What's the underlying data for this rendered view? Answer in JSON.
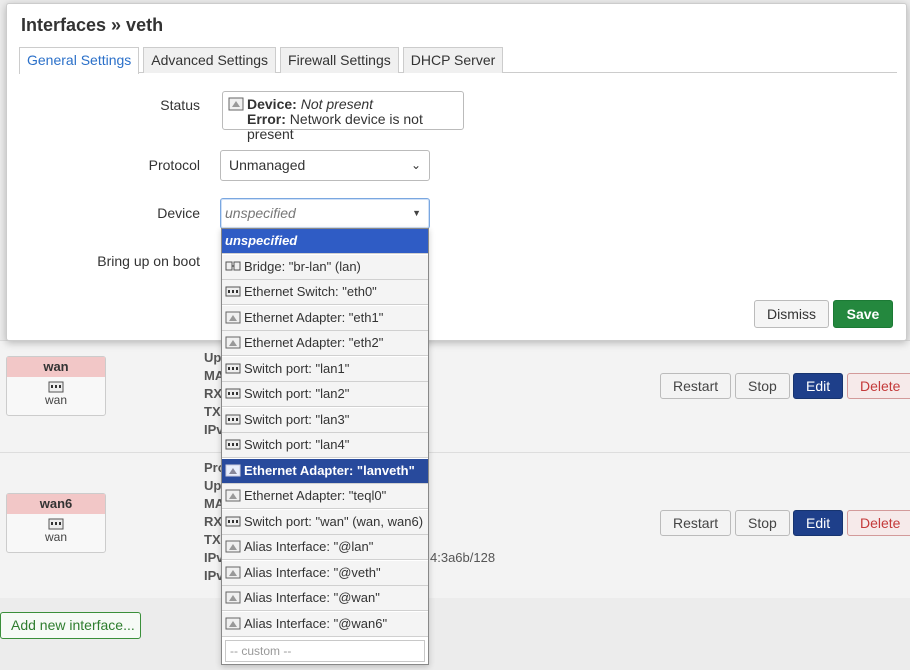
{
  "modal": {
    "title": "Interfaces » veth",
    "tabs": [
      "General Settings",
      "Advanced Settings",
      "Firewall Settings",
      "DHCP Server"
    ],
    "fields": {
      "status_label": "Status",
      "status_device_key": "Device:",
      "status_device_val": "Not present",
      "status_error_key": "Error:",
      "status_error_val": "Network device is not present",
      "protocol_label": "Protocol",
      "protocol_value": "Unmanaged",
      "device_label": "Device",
      "device_placeholder": "unspecified",
      "bringup_label": "Bring up on boot"
    },
    "dismiss_label": "Dismiss",
    "save_label": "Save"
  },
  "dropdown": {
    "items": [
      {
        "label": "unspecified",
        "icon": "none"
      },
      {
        "label": "Bridge: \"br-lan\" (lan)",
        "icon": "bridge-icon"
      },
      {
        "label": "Ethernet Switch: \"eth0\"",
        "icon": "switch-icon"
      },
      {
        "label": "Ethernet Adapter: \"eth1\"",
        "icon": "ethernet-icon"
      },
      {
        "label": "Ethernet Adapter: \"eth2\"",
        "icon": "ethernet-icon"
      },
      {
        "label": "Switch port: \"lan1\"",
        "icon": "switch-icon"
      },
      {
        "label": "Switch port: \"lan2\"",
        "icon": "switch-icon"
      },
      {
        "label": "Switch port: \"lan3\"",
        "icon": "switch-icon"
      },
      {
        "label": "Switch port: \"lan4\"",
        "icon": "switch-icon"
      },
      {
        "label": "Ethernet Adapter: \"lanveth\"",
        "icon": "ethernet-icon"
      },
      {
        "label": "Ethernet Adapter: \"teql0\"",
        "icon": "ethernet-icon"
      },
      {
        "label": "Switch port: \"wan\" (wan, wan6)",
        "icon": "switch-icon"
      },
      {
        "label": "Alias Interface: \"@lan\"",
        "icon": "alias-icon"
      },
      {
        "label": "Alias Interface: \"@veth\"",
        "icon": "alias-icon"
      },
      {
        "label": "Alias Interface: \"@wan\"",
        "icon": "alias-icon"
      },
      {
        "label": "Alias Interface: \"@wan6\"",
        "icon": "alias-icon"
      }
    ],
    "custom_placeholder": "-- custom --"
  },
  "background": {
    "interfaces": [
      {
        "name": "wan",
        "device": "wan",
        "info": [
          "Up",
          "MA",
          "RX",
          "TX",
          "IPv"
        ]
      },
      {
        "name": "wan6",
        "device": "wan",
        "info": [
          "Pro",
          "Up",
          "MA",
          "RX",
          "TX",
          "IPv",
          "IPv"
        ],
        "ipv6_suffix": "4:3a6b/128"
      }
    ],
    "row_buttons": {
      "restart": "Restart",
      "stop": "Stop",
      "edit": "Edit",
      "delete": "Delete"
    },
    "add_interface_label": "Add new interface..."
  },
  "colors": {
    "accent": "#2b70c9",
    "save_green": "#24883e",
    "highlight": "#284a9c",
    "wan_badge": "#f2c7c7"
  }
}
